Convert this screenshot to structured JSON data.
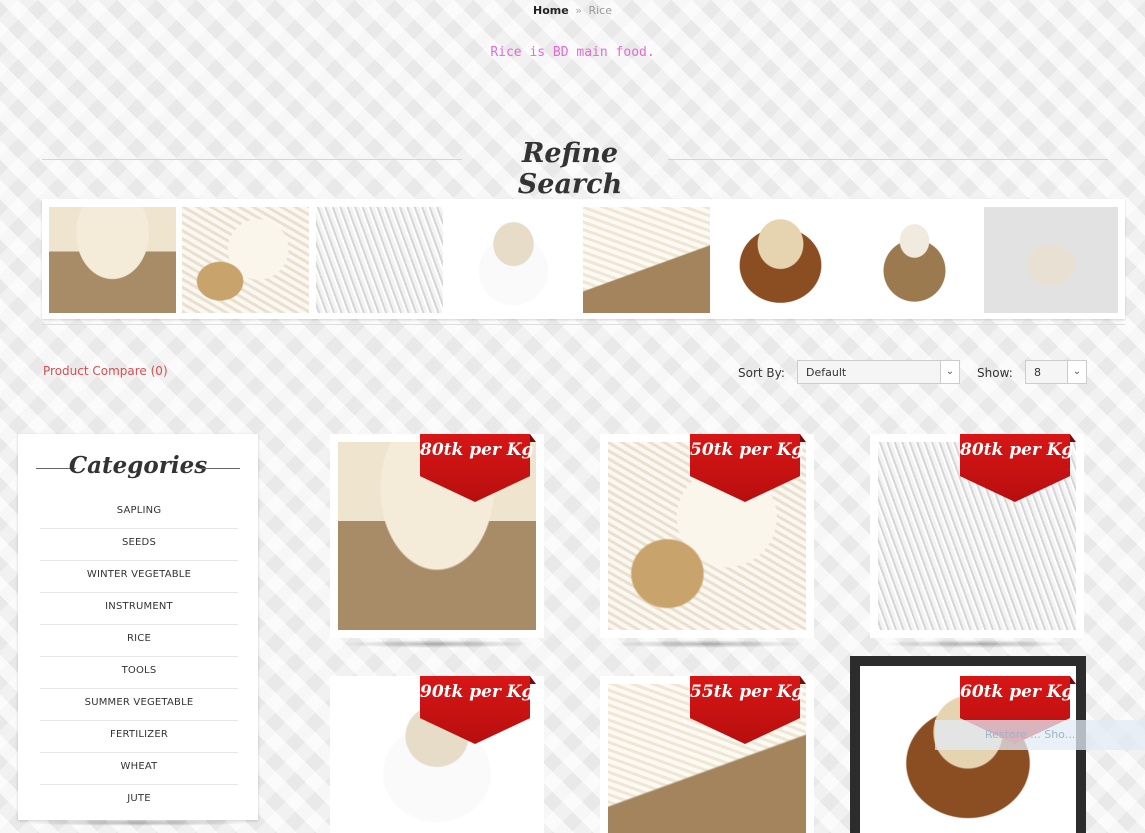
{
  "breadcrumb": {
    "home": "Home",
    "separator": "»",
    "current": "Rice"
  },
  "category_description": {
    "text": "Rice is BD main food.",
    "color": "#e36ad6"
  },
  "refine_search": {
    "title": "Refine Search",
    "thumbnails": [
      "rice-sack-image",
      "rice-scoop-image",
      "rice-grains-image",
      "rice-bag-image",
      "rice-burlap-image",
      "rice-basket-image",
      "rice-small-sack-image",
      "rice-pile-image"
    ]
  },
  "toolbar": {
    "compare_label": "Product Compare (0)",
    "sort_label": "Sort By:",
    "sort_value": "Default",
    "show_label": "Show:",
    "show_value": "8"
  },
  "categories": {
    "title": "Categories",
    "items": [
      "SAPLING",
      "SEEDS",
      "WINTER VEGETABLE",
      "INSTRUMENT",
      "RICE",
      "TOOLS",
      "SUMMER VEGETABLE",
      "FERTILIZER",
      "WHEAT",
      "JUTE"
    ]
  },
  "products": [
    {
      "price": "80tk per Kg",
      "image": "rice-sack-image"
    },
    {
      "price": "50tk per Kg",
      "image": "rice-scoop-image"
    },
    {
      "price": "80tk per Kg",
      "image": "rice-grains-image"
    },
    {
      "price": "90tk per Kg",
      "image": "rice-bag-image"
    },
    {
      "price": "55tk per Kg",
      "image": "rice-burlap-image"
    },
    {
      "price": "60tk per Kg",
      "image": "rice-basket-image"
    }
  ],
  "overlay": {
    "restore_label": "Restore ... Sho..."
  },
  "colors": {
    "accent": "#d64f4f",
    "ribbon": "#cf1414",
    "description": "#e36ad6"
  }
}
